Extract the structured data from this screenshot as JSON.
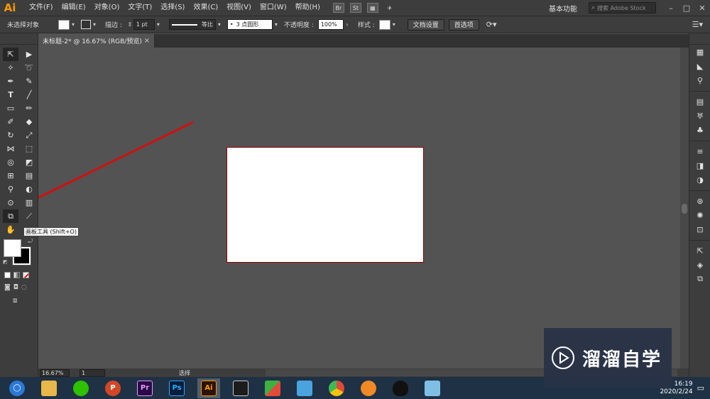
{
  "app": {
    "logo": "Ai",
    "menus": [
      "文件(F)",
      "编辑(E)",
      "对象(O)",
      "文字(T)",
      "选择(S)",
      "效果(C)",
      "视图(V)",
      "窗口(W)",
      "帮助(H)"
    ],
    "toolbar_icons": [
      "Br",
      "St"
    ],
    "workspace": "基本功能",
    "stock_placeholder": "搜索 Adobe Stock",
    "window_controls": [
      "–",
      "□",
      "✕"
    ]
  },
  "control_bar": {
    "selection_label": "未选择对象",
    "stroke_label": "描边 :",
    "stroke_value": "1 pt",
    "stroke_profile": "等比",
    "brush": "3 点圆形",
    "opacity_label": "不透明度 :",
    "opacity_value": "100%",
    "style_label": "样式 :",
    "doc_setup_button": "文档设置",
    "preferences_button": "首选项"
  },
  "document_tab": {
    "title": "未标题-2* @ 16.67% (RGB/预览)",
    "close": "×"
  },
  "tooltip": "画板工具 (Shift+O)",
  "status_bar": {
    "zoom": "16.67%",
    "page": "1",
    "tool": "选择"
  },
  "taskbar": {
    "apps": [
      {
        "name": "file-explorer",
        "label": "",
        "color": "#e8b84a"
      },
      {
        "name": "wechat",
        "label": "",
        "color": "#2dc100"
      },
      {
        "name": "powerpoint",
        "label": "P",
        "color": "#d24726"
      },
      {
        "name": "premiere",
        "label": "Pr",
        "color": "#2a0a45"
      },
      {
        "name": "photoshop",
        "label": "Ps",
        "color": "#061e3a"
      },
      {
        "name": "illustrator",
        "label": "Ai",
        "color": "#2a1300"
      },
      {
        "name": "video-editor",
        "label": "",
        "color": "#1c1c1c"
      },
      {
        "name": "bandizip",
        "label": "",
        "color": "#e24b3b"
      },
      {
        "name": "screenshot-tool",
        "label": "",
        "color": "#4aa3df"
      },
      {
        "name": "chrome",
        "label": "",
        "color": "#dd4b39"
      },
      {
        "name": "firefox-like",
        "label": "",
        "color": "#f08a24"
      },
      {
        "name": "qq",
        "label": "",
        "color": "#111111"
      },
      {
        "name": "notes",
        "label": "",
        "color": "#7fbfe6"
      }
    ],
    "clock_time": "16:19",
    "clock_date": "2020/2/24"
  },
  "watermark": {
    "text": "溜溜自学"
  }
}
